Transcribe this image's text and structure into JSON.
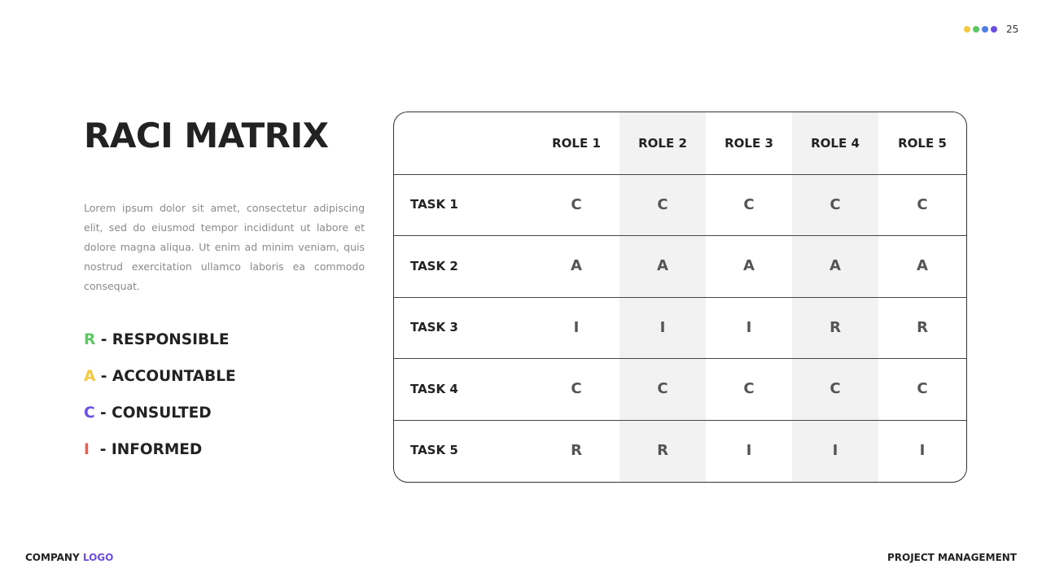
{
  "header": {
    "dots": [
      "#f5c842",
      "#5dc761",
      "#4f7fe0",
      "#6b4fe0"
    ],
    "page_number": "25"
  },
  "title": "RACI MATRIX",
  "description": "Lorem ipsum dolor sit amet, consectetur adipiscing  elit, sed do eiusmod tempor incididunt ut labore et dolore magna aliqua. Ut enim ad minim veniam, quis nostrud exercitation ullamco laboris ea commodo consequat.",
  "legend": [
    {
      "letter": "R",
      "label": " - RESPONSIBLE",
      "color": "#5dc761"
    },
    {
      "letter": "A",
      "label": " - ACCOUNTABLE",
      "color": "#f5c842"
    },
    {
      "letter": "C",
      "label": " - CONSULTED",
      "color": "#6b4fe0"
    },
    {
      "letter": "I",
      "label": "  - INFORMED",
      "color": "#ef5b4f"
    }
  ],
  "matrix": {
    "roles": [
      "ROLE 1",
      "ROLE 2",
      "ROLE 3",
      "ROLE 4",
      "ROLE 5"
    ],
    "tasks": [
      {
        "name": "TASK 1",
        "values": [
          "C",
          "C",
          "C",
          "C",
          "C"
        ]
      },
      {
        "name": "TASK 2",
        "values": [
          "A",
          "A",
          "A",
          "A",
          "A"
        ]
      },
      {
        "name": "TASK 3",
        "values": [
          "I",
          "I",
          "I",
          "R",
          "R"
        ]
      },
      {
        "name": "TASK 4",
        "values": [
          "C",
          "C",
          "C",
          "C",
          "C"
        ]
      },
      {
        "name": "TASK 5",
        "values": [
          "R",
          "R",
          "I",
          "I",
          "I"
        ]
      }
    ],
    "shade_color": "#f2f2f2"
  },
  "footer": {
    "company": "COMPANY",
    "logo": "LOGO",
    "logo_color": "#6b4fe0",
    "right": "PROJECT MANAGEMENT"
  }
}
